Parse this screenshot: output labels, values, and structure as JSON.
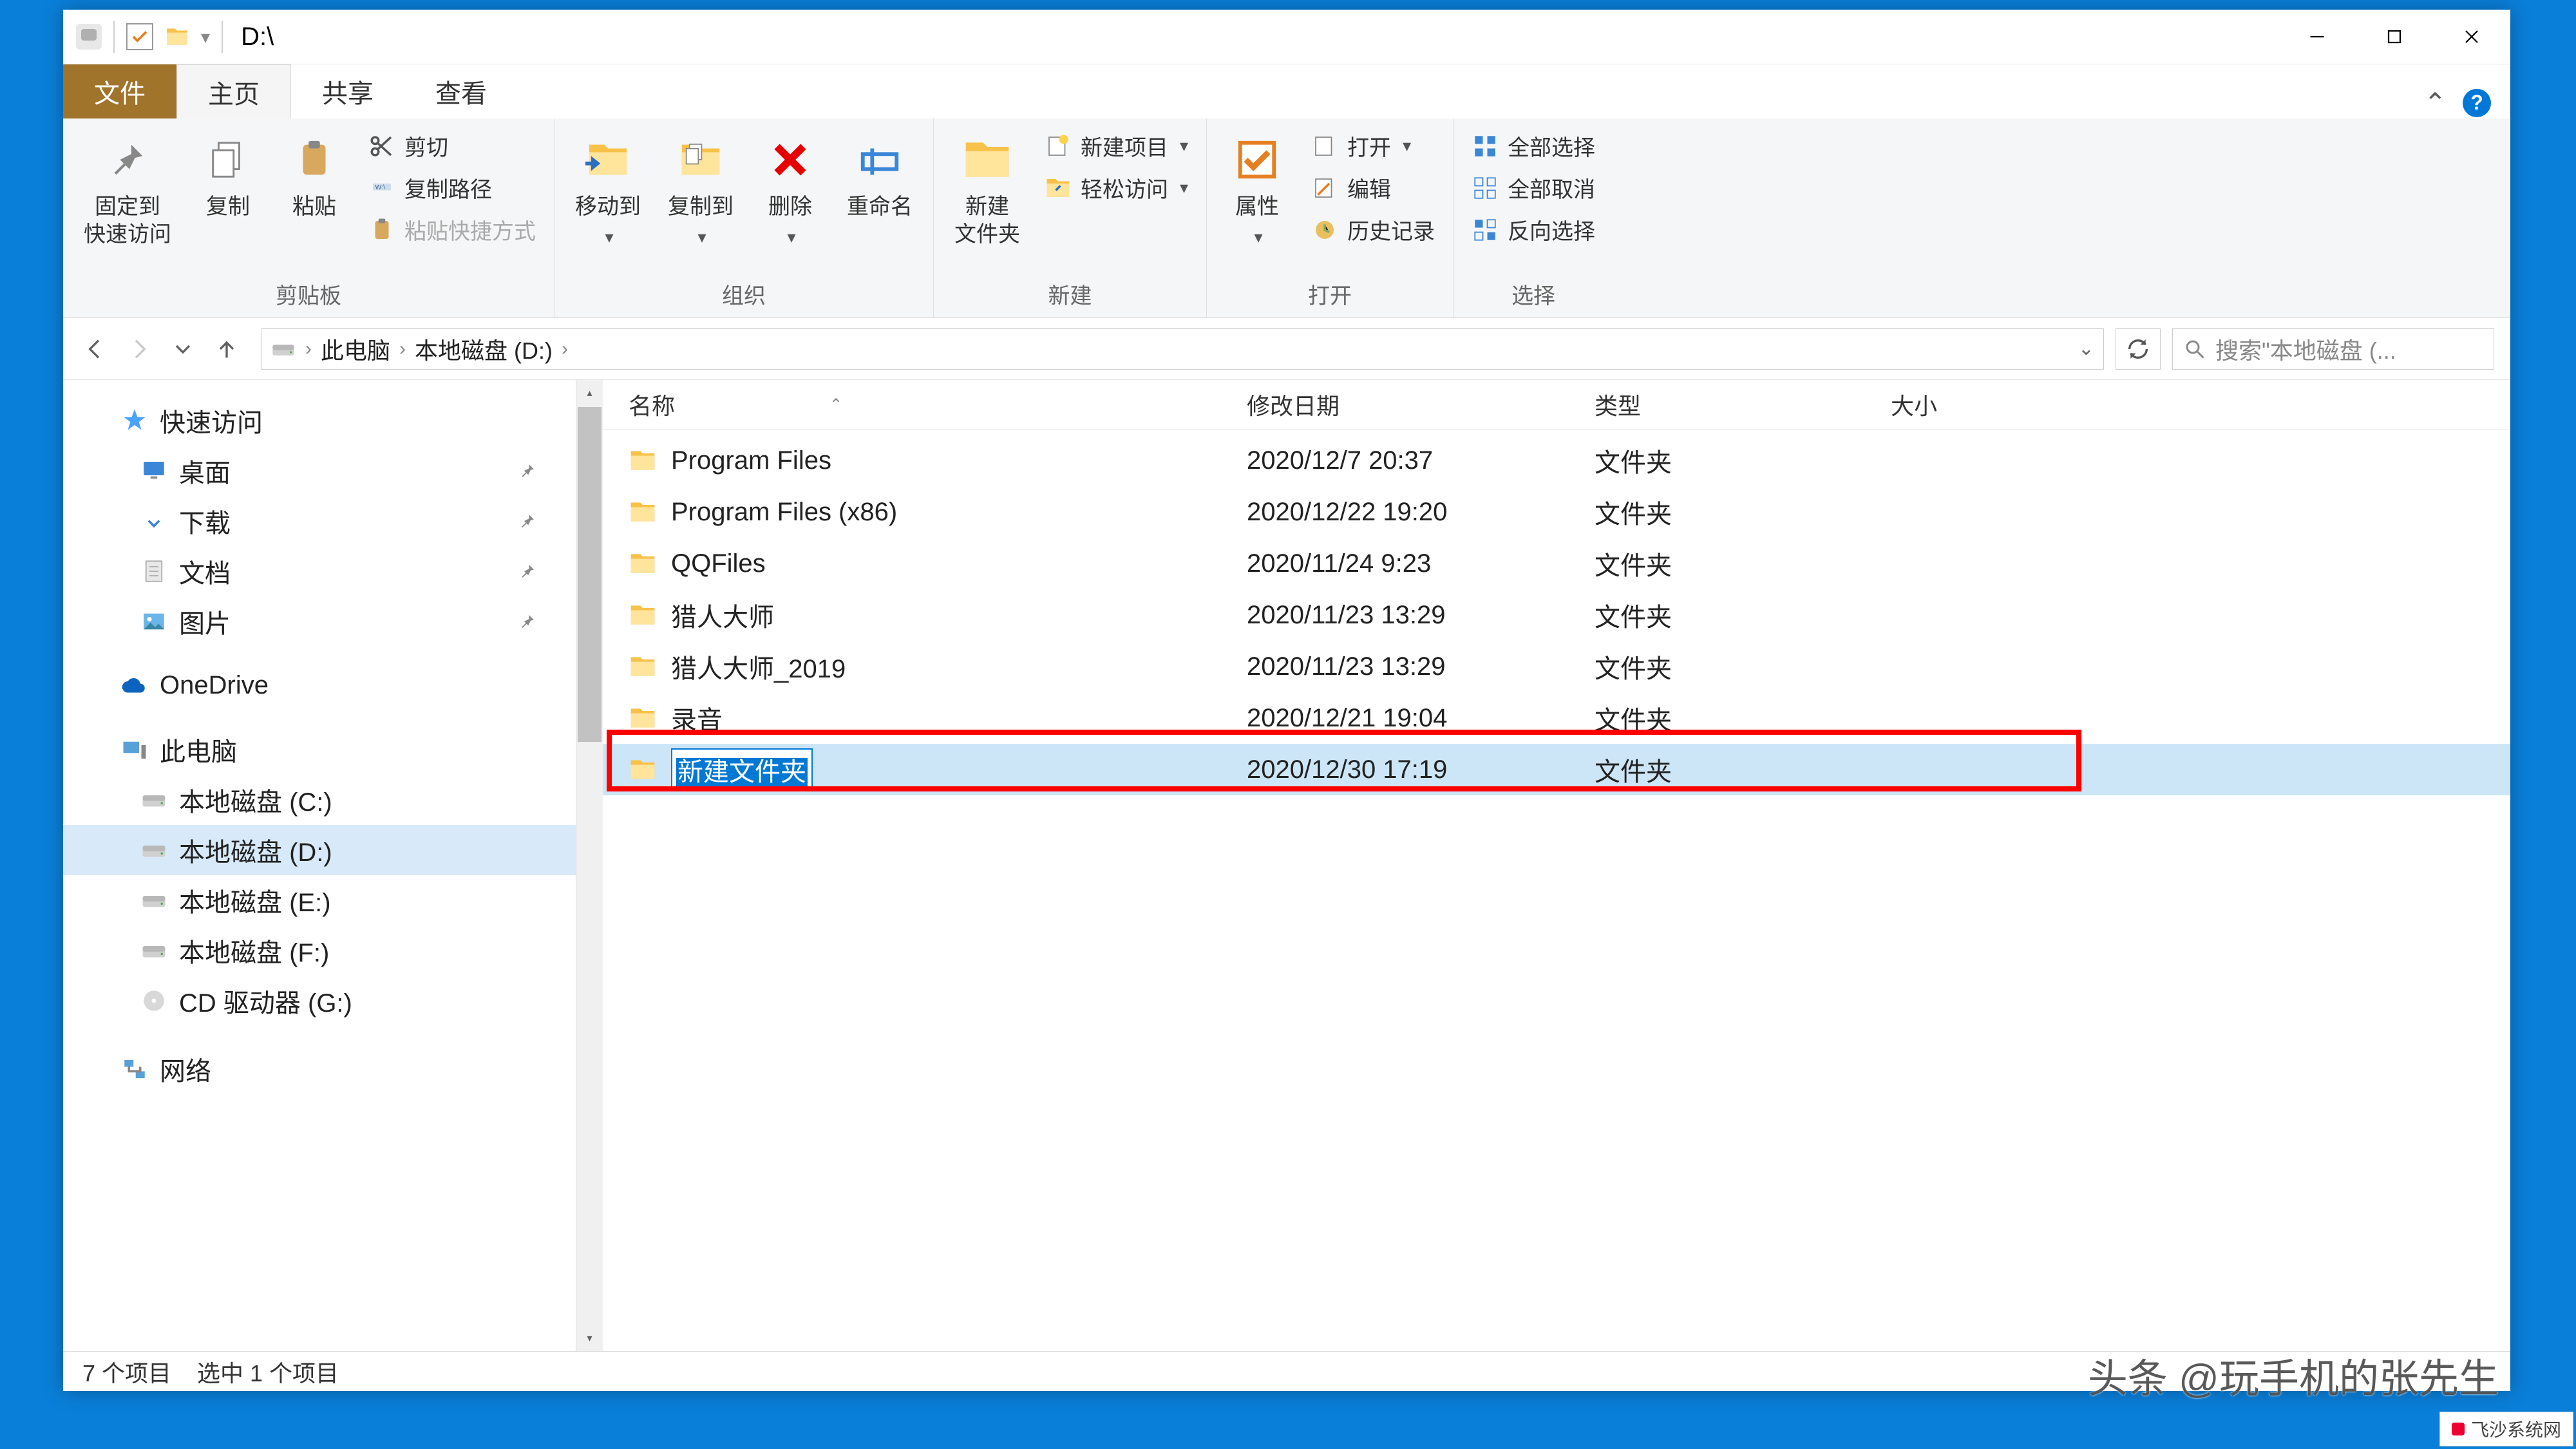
{
  "title": "D:\\",
  "window_controls": {
    "min": "minimize",
    "max": "maximize",
    "close": "close"
  },
  "tabs": {
    "file": "文件",
    "home": "主页",
    "share": "共享",
    "view": "查看"
  },
  "ribbon": {
    "groups": {
      "clipboard": {
        "label": "剪贴板",
        "pin": "固定到\n快速访问",
        "copy": "复制",
        "paste": "粘贴",
        "cut": "剪切",
        "copy_path": "复制路径",
        "paste_shortcut": "粘贴快捷方式"
      },
      "organize": {
        "label": "组织",
        "move_to": "移动到",
        "copy_to": "复制到",
        "delete": "删除",
        "rename": "重命名"
      },
      "new": {
        "label": "新建",
        "new_folder": "新建\n文件夹",
        "new_item": "新建项目",
        "easy_access": "轻松访问"
      },
      "open": {
        "label": "打开",
        "properties": "属性",
        "open": "打开",
        "edit": "编辑",
        "history": "历史记录"
      },
      "select": {
        "label": "选择",
        "select_all": "全部选择",
        "select_none": "全部取消",
        "invert": "反向选择"
      }
    }
  },
  "breadcrumb": {
    "pc": "此电脑",
    "drive": "本地磁盘 (D:)"
  },
  "search_placeholder": "搜索\"本地磁盘 (...",
  "sidebar": {
    "quick_access": "快速访问",
    "desktop": "桌面",
    "downloads": "下载",
    "documents": "文档",
    "pictures": "图片",
    "onedrive": "OneDrive",
    "this_pc": "此电脑",
    "drive_c": "本地磁盘 (C:)",
    "drive_d": "本地磁盘 (D:)",
    "drive_e": "本地磁盘 (E:)",
    "drive_f": "本地磁盘 (F:)",
    "cd_drive": "CD 驱动器 (G:)",
    "network": "网络"
  },
  "columns": {
    "name": "名称",
    "date": "修改日期",
    "type": "类型",
    "size": "大小"
  },
  "files": [
    {
      "name": "Program Files",
      "date": "2020/12/7 20:37",
      "type": "文件夹"
    },
    {
      "name": "Program Files (x86)",
      "date": "2020/12/22 19:20",
      "type": "文件夹"
    },
    {
      "name": "QQFiles",
      "date": "2020/11/24 9:23",
      "type": "文件夹"
    },
    {
      "name": "猎人大师",
      "date": "2020/11/23 13:29",
      "type": "文件夹"
    },
    {
      "name": "猎人大师_2019",
      "date": "2020/11/23 13:29",
      "type": "文件夹"
    },
    {
      "name": "录音",
      "date": "2020/12/21 19:04",
      "type": "文件夹"
    },
    {
      "name": "新建文件夹",
      "date": "2020/12/30 17:19",
      "type": "文件夹"
    }
  ],
  "selected_edit_name": "新建文件夹",
  "status": {
    "count": "7 个项目",
    "selected": "选中 1 个项目"
  },
  "watermark": "头条 @玩手机的张先生",
  "corner": "飞沙系统网"
}
